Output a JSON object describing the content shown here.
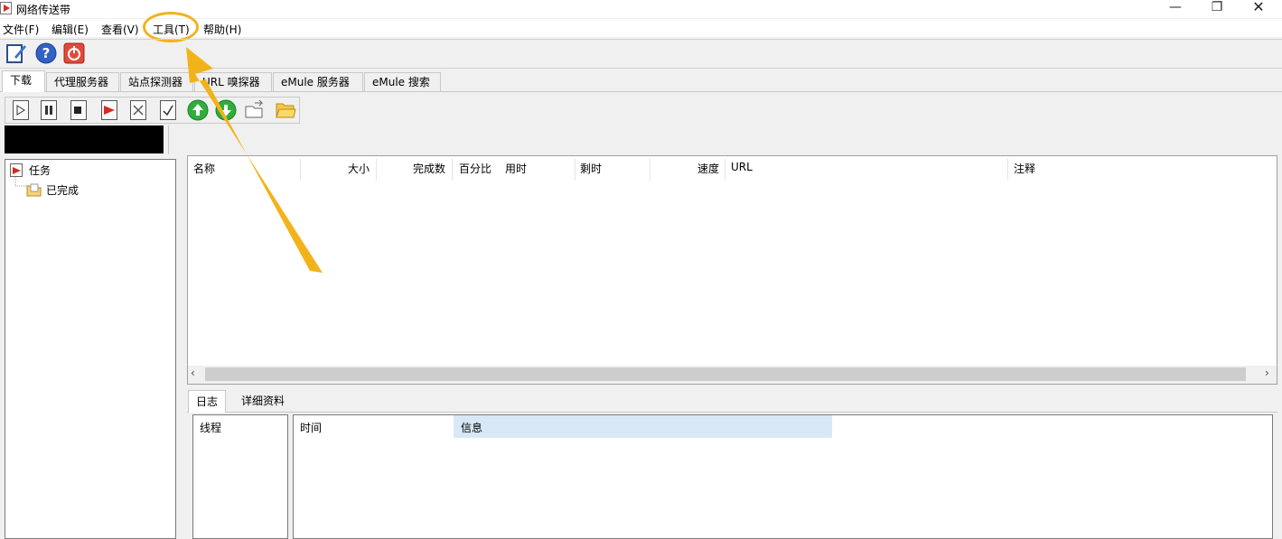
{
  "window": {
    "title": "网络传送带"
  },
  "menu": [
    "文件(F)",
    "编辑(E)",
    "查看(V)",
    "工具(T)",
    "帮助(H)"
  ],
  "tabs": [
    "下载",
    "代理服务器",
    "站点探测器",
    "URL 嗅探器",
    "eMule 服务器",
    "eMule 搜索"
  ],
  "active_tab_index": 0,
  "tree": {
    "root": "任务",
    "child": "已完成"
  },
  "columns": [
    "名称",
    "大小",
    "完成数",
    "百分比",
    "用时",
    "剩时",
    "速度",
    "URL",
    "注释"
  ],
  "bottom_tabs": [
    "日志",
    "详细资料"
  ],
  "log_headers": {
    "thread": "线程",
    "time": "时间",
    "info": "信息"
  },
  "highlight": {
    "target": "工具(T)",
    "color": "#f2b31a"
  },
  "icons": {
    "toolbar_main": [
      "open-doc-icon",
      "help-icon",
      "exit-icon"
    ],
    "toolbar_download": [
      "start-icon",
      "pause-icon",
      "stop-icon",
      "add-task-icon",
      "delete-icon",
      "check-icon",
      "move-up-icon",
      "move-down-icon",
      "open-file-icon",
      "open-folder-icon"
    ]
  }
}
